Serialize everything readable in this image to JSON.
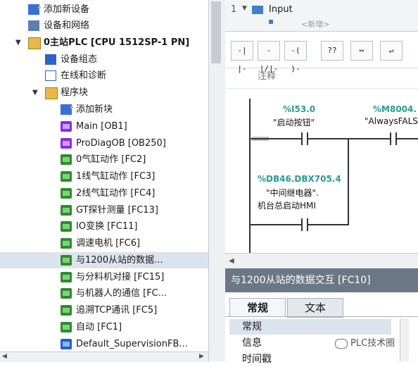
{
  "tree": {
    "items": [
      {
        "label": "添加新设备",
        "icon": "add-device-icon"
      },
      {
        "label": "设备和网络",
        "icon": "network-icon"
      },
      {
        "label": "0主站PLC [CPU 1512SP-1 PN]",
        "icon": "plc-icon"
      },
      {
        "label": "设备组态",
        "icon": "device-config-icon"
      },
      {
        "label": "在线和诊断",
        "icon": "online-diagnostics-icon"
      },
      {
        "label": "程序块",
        "icon": "folder-icon"
      },
      {
        "label": "添加新块",
        "icon": "add-block-icon"
      },
      {
        "label": "Main [OB1]",
        "icon": "ob-block-icon"
      },
      {
        "label": "ProDiagOB [OB250]",
        "icon": "ob-block-icon"
      },
      {
        "label": "0气缸动作 [FC2]",
        "icon": "fc-block-icon"
      },
      {
        "label": "1线气缸动作 [FC3]",
        "icon": "fc-block-icon"
      },
      {
        "label": "2线气缸动作 [FC4]",
        "icon": "fc-block-icon"
      },
      {
        "label": "GT探针测量 [FC13]",
        "icon": "fc-block-icon"
      },
      {
        "label": "IO变换 [FC11]",
        "icon": "fc-block-icon"
      },
      {
        "label": "调速电机 [FC6]",
        "icon": "fc-block-icon"
      },
      {
        "label": "与1200从站的数据...",
        "icon": "fc-block-icon"
      },
      {
        "label": "与分料机对接 [FC15]",
        "icon": "fc-block-icon"
      },
      {
        "label": "与机器人的通信 [FC...",
        "icon": "fc-block-icon"
      },
      {
        "label": "追溯TCP通讯 [FC5]",
        "icon": "fc-block-icon"
      },
      {
        "label": "自动 [FC1]",
        "icon": "fc-block-icon"
      },
      {
        "label": "Default_SupervisionFB...",
        "icon": "fb-block-icon"
      }
    ]
  },
  "editor": {
    "interface": {
      "row_number": "1",
      "label": "Input",
      "add_new": "<新增>"
    },
    "toolbar": [
      "-| |-",
      "-|/|-",
      "-( )-",
      "??",
      "↦",
      "↵"
    ],
    "comment_label": "注释",
    "network": {
      "contact1_address": "%I53.0",
      "contact1_symbol": "\"启动按钮\"",
      "contact2_address": "%M8004.",
      "contact2_symbol": "\"AlwaysFALS",
      "contact3_address": "%DB46.DBX705.4",
      "contact3_symbol_line1": "\"中间继电器\".",
      "contact3_symbol_line2": "机台总启动HMI"
    }
  },
  "properties": {
    "title": "与1200从站的数据交互 [FC10]",
    "tabs": [
      "常规",
      "文本"
    ],
    "list": [
      "常规",
      "信息",
      "时间戳"
    ]
  },
  "watermark": "PLC技术圈",
  "colors": {
    "accent": "#2a9a97",
    "selection": "#dce3ec",
    "panel_header": "#6b7785"
  }
}
